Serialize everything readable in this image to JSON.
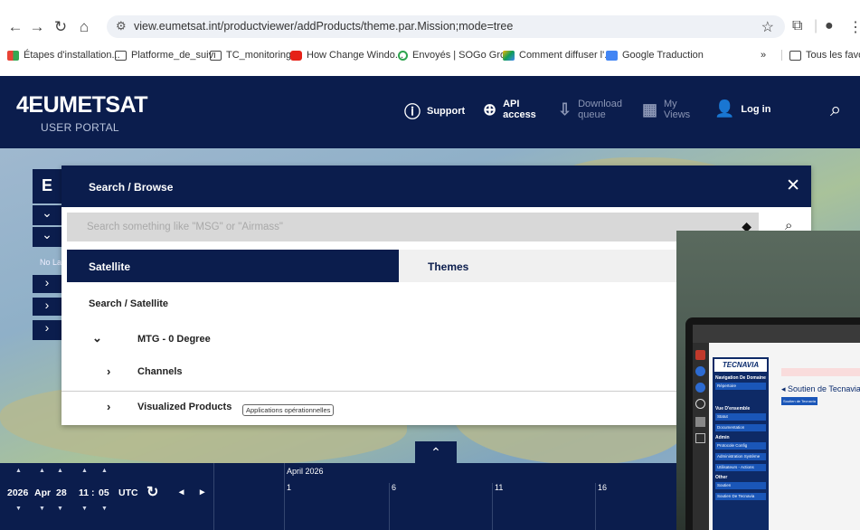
{
  "browser": {
    "url": "view.eumetsat.int/productviewer/addProducts/theme.par.Mission;mode=tree",
    "bookmarks": [
      "Étapes d'installation...",
      "Platforme_de_suivi",
      "TC_monitoring",
      "How Change Windo...",
      "Envoyés | SOGo Gro...",
      "Comment diffuser l'...",
      "Google Traduction"
    ],
    "bookmarks_overflow": "»",
    "all_bookmarks": "Tous les favori"
  },
  "portal": {
    "logo": "EUMETSAT",
    "logo_prefix": "4",
    "logo_sub": "USER PORTAL",
    "nav": {
      "support": "Support",
      "api_line1": "API",
      "api_line2": "access",
      "download_line1": "Download",
      "download_line2": "queue",
      "views_line1": "My",
      "views_line2": "Views",
      "login": "Log in"
    }
  },
  "sidebar": {
    "partial_title": "E",
    "partial_text": "No La"
  },
  "modal": {
    "title": "Search / Browse",
    "search_placeholder": "Search something like \"MSG\" or \"Airmass\"",
    "tabs": [
      "Satellite",
      "Themes"
    ],
    "breadcrumb": "Search  /  Satellite",
    "tree": [
      {
        "label": "MTG - 0 Degree",
        "expanded": true
      },
      {
        "label": "Channels",
        "expanded": false
      },
      {
        "label": "Visualized Products",
        "expanded": false
      }
    ],
    "tooltip": "Applications opérationnelles"
  },
  "timeline": {
    "year": "2026",
    "month": "Apr",
    "day": "28",
    "hour": "11",
    "minute": "05",
    "tz": "UTC",
    "period_label": "April 2026",
    "ticks": [
      "1",
      "6",
      "11",
      "16"
    ]
  },
  "photo_overlay": {
    "brand": "TECNAVIA",
    "heading": "Soutien de Tecnavia",
    "button": "Soutien de Tecnavia",
    "nav_title": "Navigation De Domaine",
    "nav_items": [
      "Répertoire",
      "Vue D'ensemble",
      "Statut",
      "Documentation",
      "Admin",
      "Protocole Config",
      "Administration Système",
      "Utilisateurs - Actions",
      "Other",
      "Soutien",
      "Soutien De Tecnavia"
    ]
  },
  "colors": {
    "portal_navy": "#0b1d4d",
    "search_bg": "#d8d8d8"
  }
}
